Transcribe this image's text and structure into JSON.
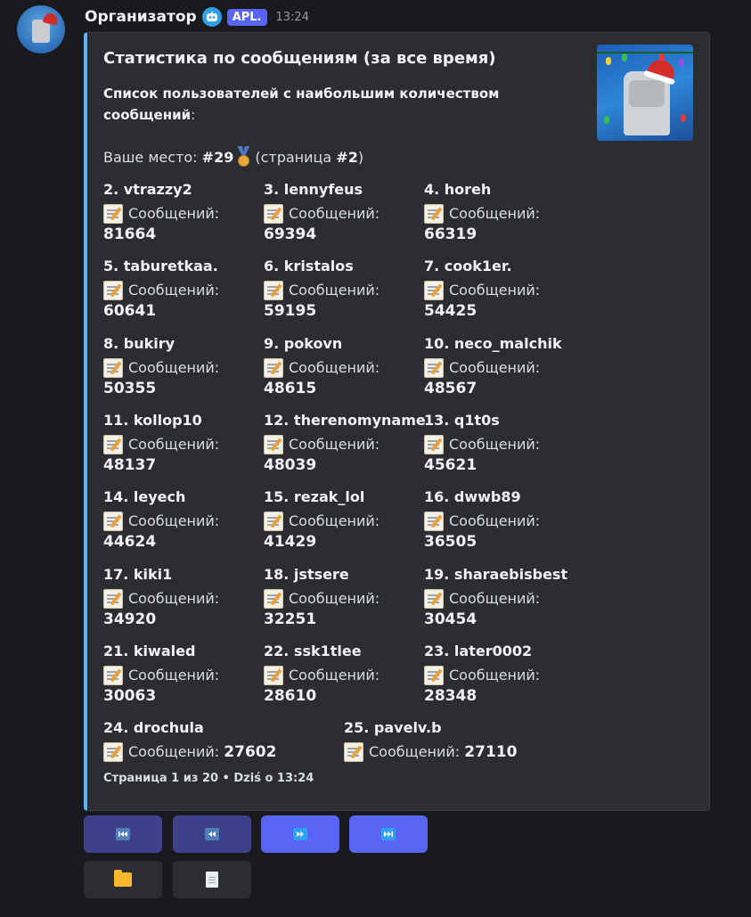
{
  "message": {
    "author": "Организатор",
    "badge": "APL.",
    "time": "13:24",
    "avatar_icon": "robot-santa-avatar",
    "bot_icon": "bot-robot-icon"
  },
  "embed": {
    "accent_color": "#5ab5f0",
    "title": "Статистика по сообщениям (за все время)",
    "desc_bold": "Список пользователей с наибольшим количеством сообщений",
    "desc_suffix": ":",
    "rank_prefix": "Ваше место:",
    "rank_value": "#29",
    "rank_medal_icon": "medal-icon",
    "rank_page_open": "(страница",
    "rank_page_value": "#2",
    "rank_page_close": ")",
    "field_label": "Сообщений:",
    "field_icon": "memo-icon",
    "fields": [
      {
        "name": "2. vtrazzy2",
        "value": "81664"
      },
      {
        "name": "3. lennyfeus",
        "value": "69394"
      },
      {
        "name": "4. horeh",
        "value": "66319"
      },
      {
        "name": "5. taburetkaa.",
        "value": "60641"
      },
      {
        "name": "6. kristalos",
        "value": "59195"
      },
      {
        "name": "7. cook1er.",
        "value": "54425"
      },
      {
        "name": "8. bukiry",
        "value": "50355"
      },
      {
        "name": "9. pokovn",
        "value": "48615"
      },
      {
        "name": "10. neco_malchik",
        "value": "48567"
      },
      {
        "name": "11. kollop10",
        "value": "48137"
      },
      {
        "name": "12. therenomyname",
        "value": "48039"
      },
      {
        "name": "13. q1t0s",
        "value": "45621"
      },
      {
        "name": "14. leyech",
        "value": "44624"
      },
      {
        "name": "15. rezak_lol",
        "value": "41429"
      },
      {
        "name": "16. dwwb89",
        "value": "36505"
      },
      {
        "name": "17. kiki1",
        "value": "34920"
      },
      {
        "name": "18. jstsere",
        "value": "32251"
      },
      {
        "name": "19. sharaebisbest",
        "value": "30454"
      },
      {
        "name": "21. kiwaled",
        "value": "30063"
      },
      {
        "name": "22. ssk1tlee",
        "value": "28610"
      },
      {
        "name": "23. later0002",
        "value": "28348"
      },
      {
        "name": "24. drochula",
        "value": "27602"
      },
      {
        "name": "25. pavelv.b",
        "value": "27110"
      }
    ],
    "footer": "Страница 1 из 20 • Dziś o 13:24"
  },
  "buttons": {
    "first_page_icon": "first-page-icon",
    "prev_page_icon": "previous-page-icon",
    "next_page_icon": "next-page-icon",
    "last_page_icon": "last-page-icon",
    "folder_icon": "folder-icon",
    "page_icon": "page-icon"
  }
}
